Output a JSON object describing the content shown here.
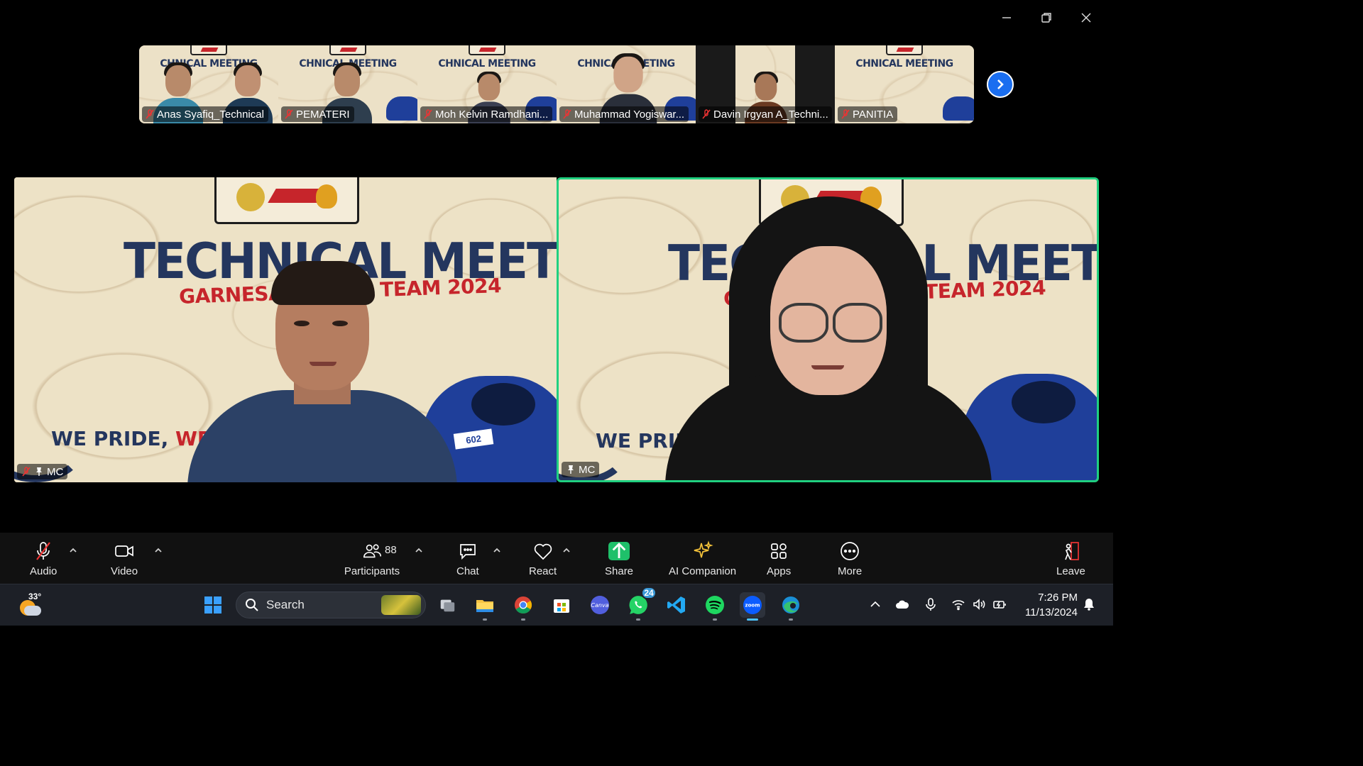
{
  "window": {
    "minimize_icon": "minimize-icon",
    "restore_icon": "restore-icon",
    "close_icon": "close-icon"
  },
  "thumbnails": [
    {
      "name": "Anas Syafiq_Technical",
      "muted": true
    },
    {
      "name": "PEMATERI",
      "muted": true
    },
    {
      "name": "Moh Kelvin Ramdhani...",
      "muted": true
    },
    {
      "name": "Muhammad Yogiswar...",
      "muted": true
    },
    {
      "name": "Davin Irgyan A_Techni...",
      "muted": true
    },
    {
      "name": "PANITIA",
      "muted": true
    }
  ],
  "thumb_banner": "CHNICAL MEETING",
  "main_tiles": [
    {
      "name": "MC",
      "muted": true,
      "pinned": true,
      "active_speaker": false
    },
    {
      "name": "MC",
      "muted": false,
      "pinned": true,
      "active_speaker": true
    }
  ],
  "background_art": {
    "headline": "TECHNICAL MEETING",
    "subline": "GARNESA RACING TEAM 2024",
    "slogan_a": "WE PRIDE,",
    "slogan_b": "WE TRUST",
    "kart_number": "602"
  },
  "toolbar": {
    "audio_label": "Audio",
    "video_label": "Video",
    "participants_label": "Participants",
    "participants_count": "88",
    "chat_label": "Chat",
    "react_label": "React",
    "share_label": "Share",
    "ai_label": "AI Companion",
    "apps_label": "Apps",
    "more_label": "More",
    "leave_label": "Leave"
  },
  "taskbar": {
    "temperature": "33°",
    "search_placeholder": "Search",
    "whatsapp_badge": "24",
    "time": "7:26 PM",
    "date": "11/13/2024"
  },
  "colors": {
    "active_speaker_border": "#20d080",
    "share_green": "#1fc06a",
    "next_button": "#1a6ef0",
    "banner_navy": "#24365e",
    "banner_red": "#c6252b"
  }
}
